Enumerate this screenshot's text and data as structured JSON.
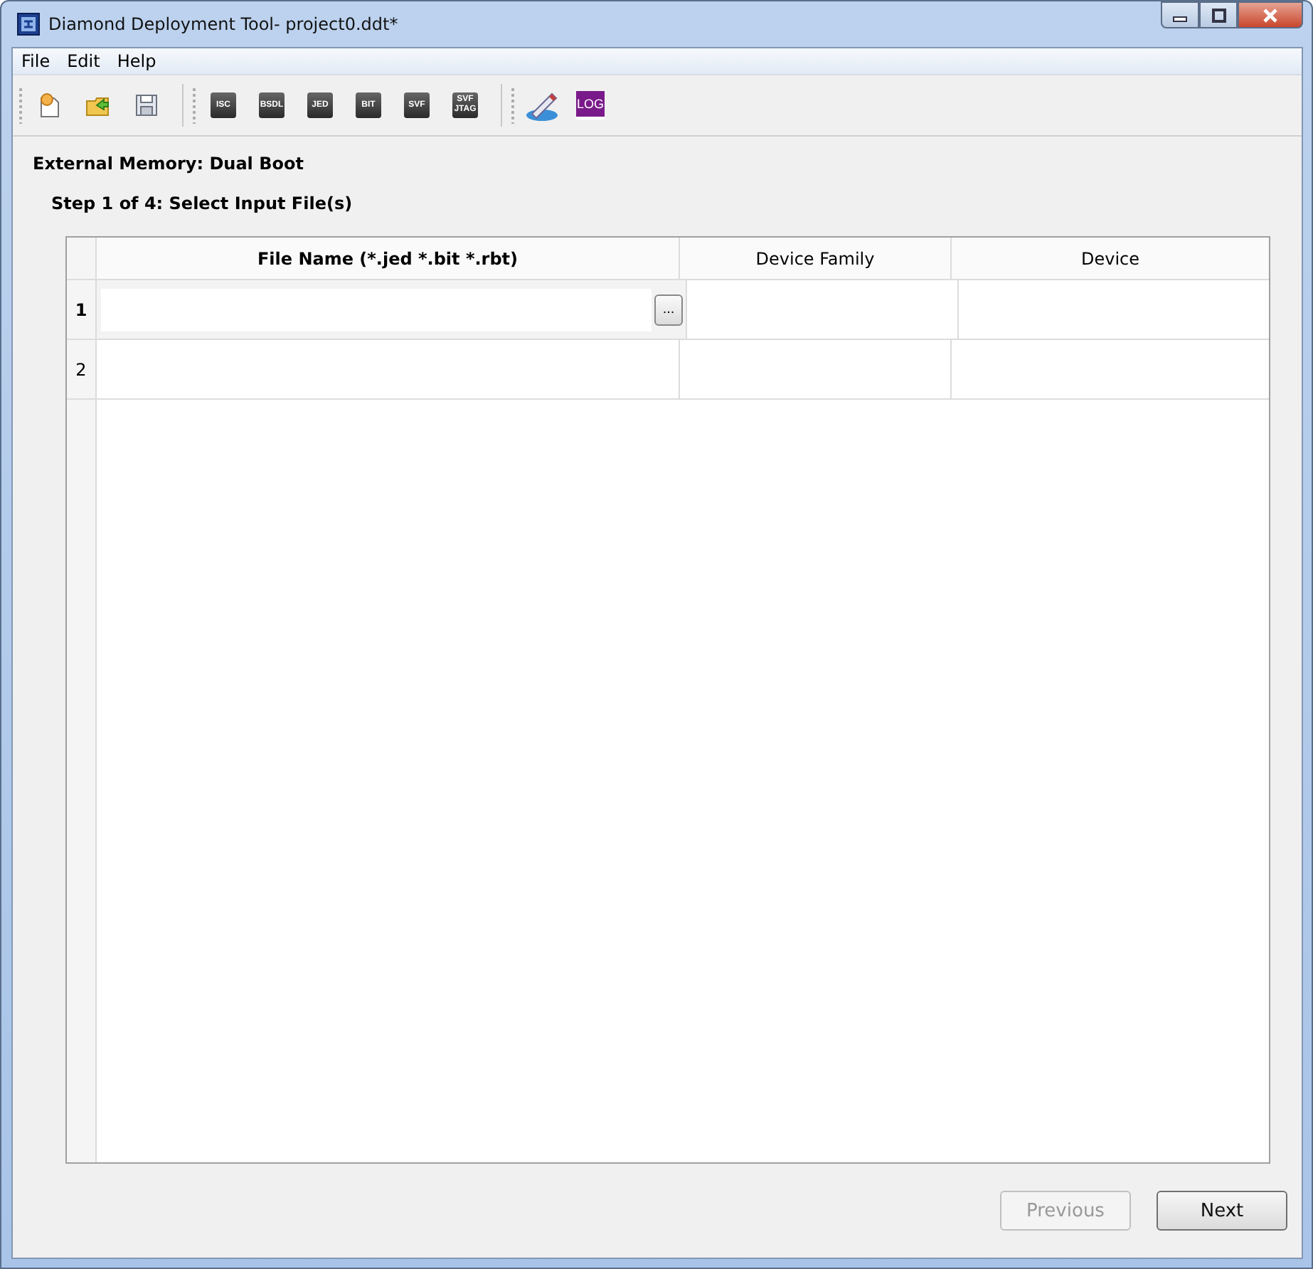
{
  "window": {
    "title": "Diamond Deployment Tool- project0.ddt*"
  },
  "menu": [
    "File",
    "Edit",
    "Help"
  ],
  "toolbar": [
    {
      "kind": "new"
    },
    {
      "kind": "open"
    },
    {
      "kind": "save"
    },
    {
      "kind": "separator"
    },
    {
      "kind": "tag",
      "label": "ISC"
    },
    {
      "kind": "tag",
      "label": "BSDL"
    },
    {
      "kind": "tag",
      "label": "JED"
    },
    {
      "kind": "tag",
      "label": "BIT"
    },
    {
      "kind": "tag",
      "label": "SVF"
    },
    {
      "kind": "tag",
      "label": "SVF JTAG"
    },
    {
      "kind": "separator"
    },
    {
      "kind": "pen"
    },
    {
      "kind": "log",
      "label": "LOG"
    }
  ],
  "heading": "External Memory:  Dual Boot",
  "step": "Step 1 of 4: Select Input File(s)",
  "table": {
    "columns": [
      "File Name (*.jed *.bit *.rbt)",
      "Device Family",
      "Device"
    ],
    "rows": [
      {
        "number": "1",
        "editing": true,
        "browse": "..."
      },
      {
        "number": "2",
        "editing": false
      }
    ]
  },
  "buttons": [
    {
      "label": "Previous",
      "disabled": true
    },
    {
      "label": "Next",
      "disabled": false
    }
  ]
}
